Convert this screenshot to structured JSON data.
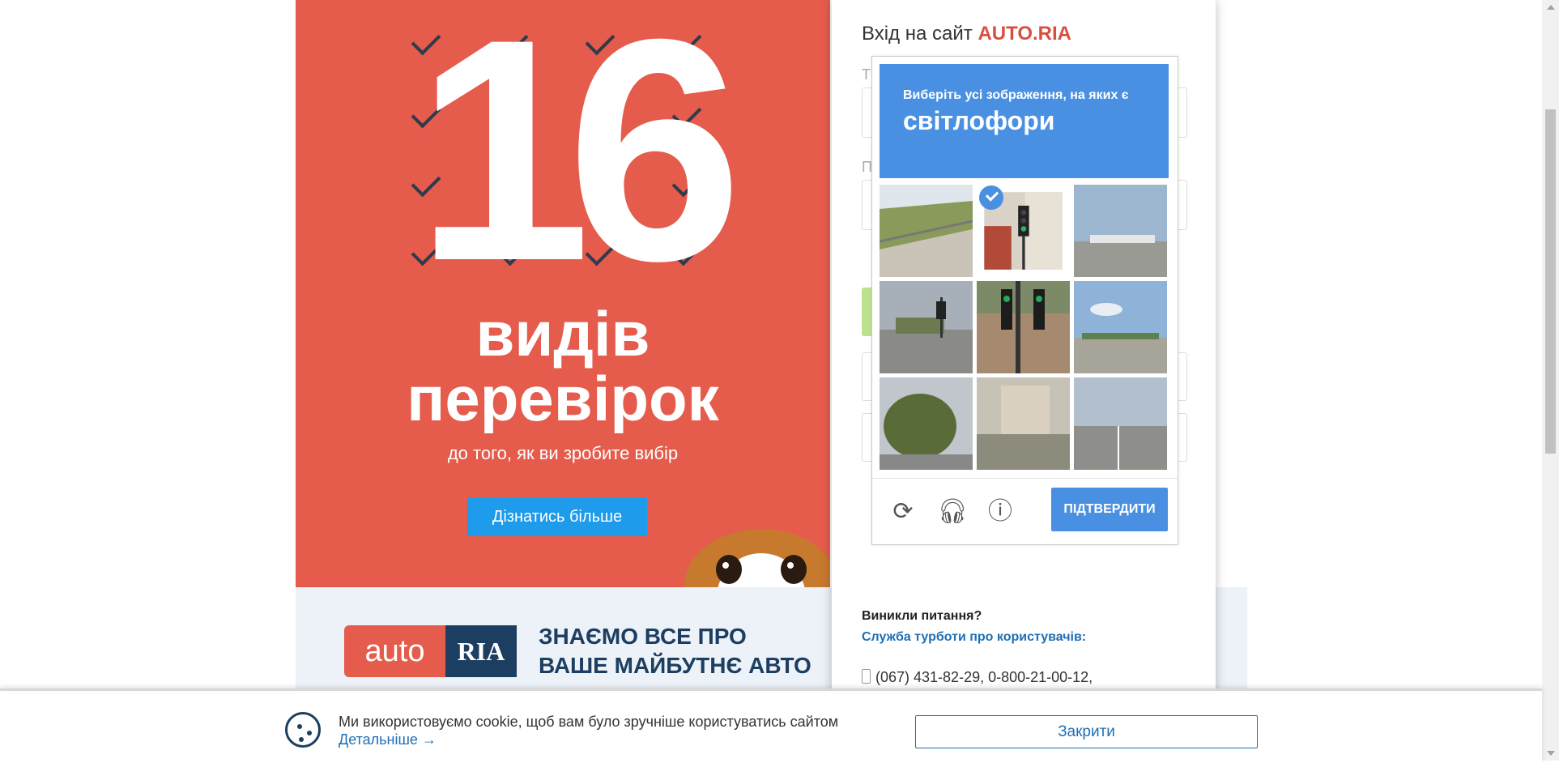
{
  "promo": {
    "big_number": "16",
    "line1": "видів",
    "line2": "перевірок",
    "line3": "до того, як ви зробите вибір",
    "button": "Дізнатись більше"
  },
  "banner": {
    "logo_auto": "auto",
    "logo_ria": "RIA",
    "tagline_1": "ЗНАЄМО ВСЕ ПРО",
    "tagline_2": "ВАШЕ МАЙБУТНЄ АВТО"
  },
  "login": {
    "title_prefix": "Вхід на сайт",
    "title_brand": "AUTO.RIA",
    "help_title": "Виникли питання?",
    "help_link": "Служба турботи про користувачів:",
    "phones": "(067) 431-82-29, 0-800-21-00-12,"
  },
  "captcha": {
    "instruction": "Виберіть усі зображення, на яких є",
    "target": "світлофори",
    "verify_button": "ПІДТВЕРДИТИ",
    "selected_tiles": [
      2
    ],
    "icons": [
      "reload-icon",
      "audio-icon",
      "info-icon"
    ]
  },
  "cookie": {
    "text": "Ми використовуємо cookie, щоб вам було зручніше користуватись сайтом",
    "more_link": "Детальніше →",
    "close_button": "Закрити"
  },
  "colors": {
    "promo_bg": "#e55c4c",
    "captcha_blue": "#4a90e2",
    "brand_dark": "#1c3e60",
    "link_blue": "#1f6fb5"
  }
}
